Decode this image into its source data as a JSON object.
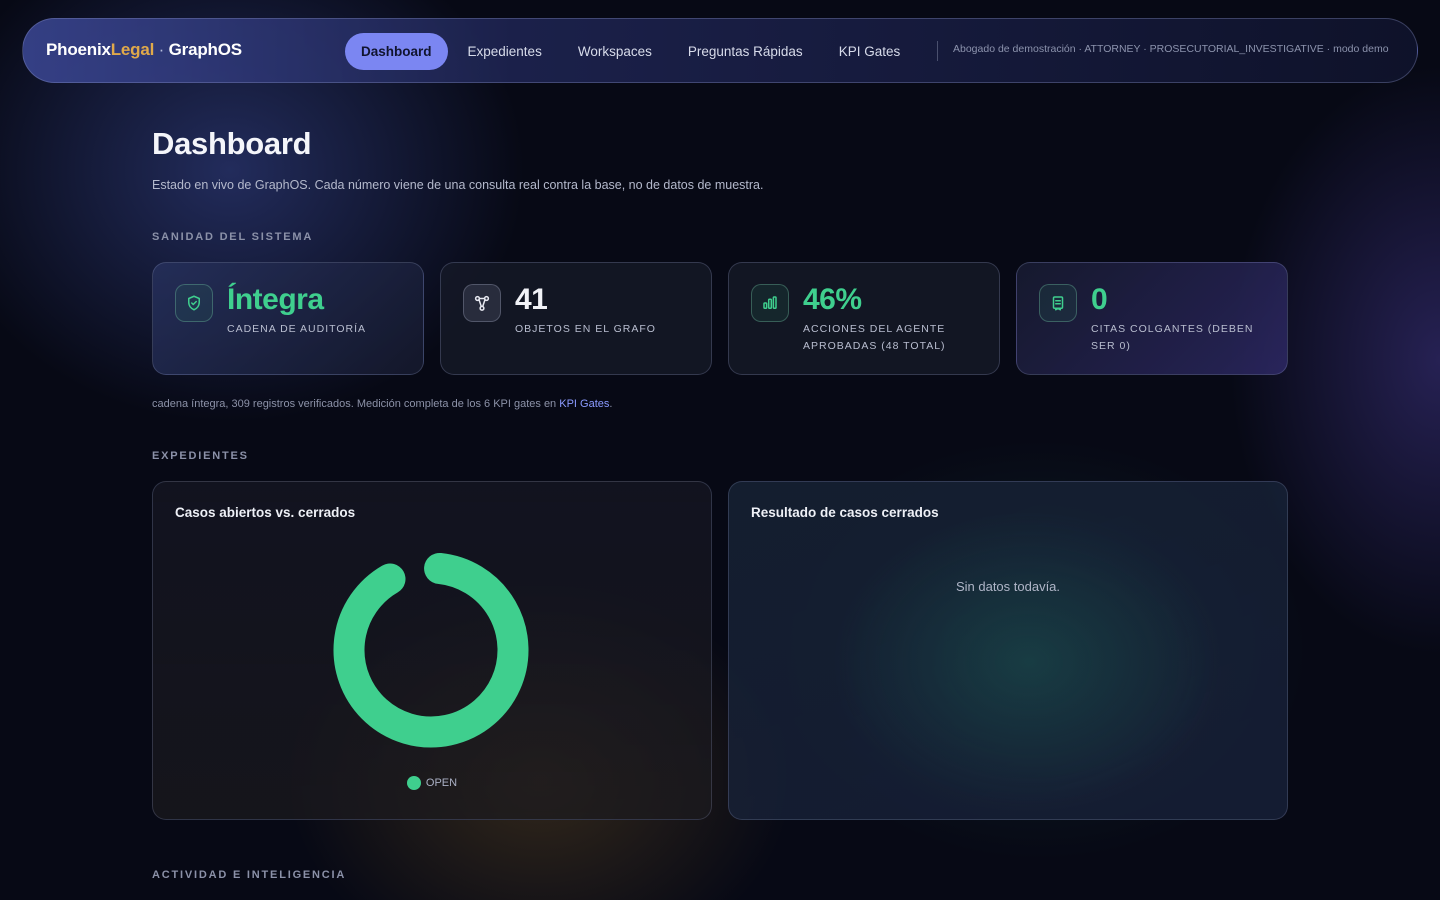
{
  "brand": {
    "part1": "Phoenix",
    "part2": "Legal",
    "separator": " · ",
    "part3": "GraphOS"
  },
  "nav": {
    "tabs": [
      {
        "label": "Dashboard",
        "active": true
      },
      {
        "label": "Expedientes",
        "active": false
      },
      {
        "label": "Workspaces",
        "active": false
      },
      {
        "label": "Preguntas Rápidas",
        "active": false
      },
      {
        "label": "KPI Gates",
        "active": false
      }
    ],
    "user_info": "Abogado de demostración · ATTORNEY · PROSECUTORIAL_INVESTIGATIVE · modo demo"
  },
  "page": {
    "title": "Dashboard",
    "subtitle": "Estado en vivo de GraphOS. Cada número viene de una consulta real contra la base, no de datos de muestra."
  },
  "system": {
    "section_label": "SANIDAD DEL SISTEMA",
    "cards": [
      {
        "value": "Íntegra",
        "label": "CADENA DE AUDITORÍA",
        "icon": "shield-check-icon",
        "color": "#3fcf8e"
      },
      {
        "value": "41",
        "label": "OBJETOS EN EL GRAFO",
        "icon": "graph-nodes-icon",
        "color": "#f1f2f7"
      },
      {
        "value": "46%",
        "label": "ACCIONES DEL AGENTE APROBADAS (48 TOTAL)",
        "icon": "bar-chart-icon",
        "color": "#3fcf8e"
      },
      {
        "value": "0",
        "label": "CITAS COLGANTES (DEBEN SER 0)",
        "icon": "bookmark-icon",
        "color": "#3fcf8e"
      }
    ],
    "note_prefix": "cadena íntegra, 309 registros verificados. Medición completa de los 6 KPI gates en ",
    "note_link": "KPI Gates",
    "note_suffix": "."
  },
  "cases": {
    "section_label": "EXPEDIENTES",
    "open_closed_title": "Casos abiertos vs. cerrados",
    "results_title": "Resultado de casos cerrados",
    "results_empty": "Sin datos todavía."
  },
  "activity": {
    "section_label": "ACTIVIDAD E INTELIGENCIA"
  },
  "chart_data": {
    "type": "pie",
    "title": "Casos abiertos vs. cerrados",
    "categories": [
      "OPEN"
    ],
    "values": [
      1
    ],
    "colors": [
      "#3fcf8e"
    ],
    "legend": "bottom"
  }
}
